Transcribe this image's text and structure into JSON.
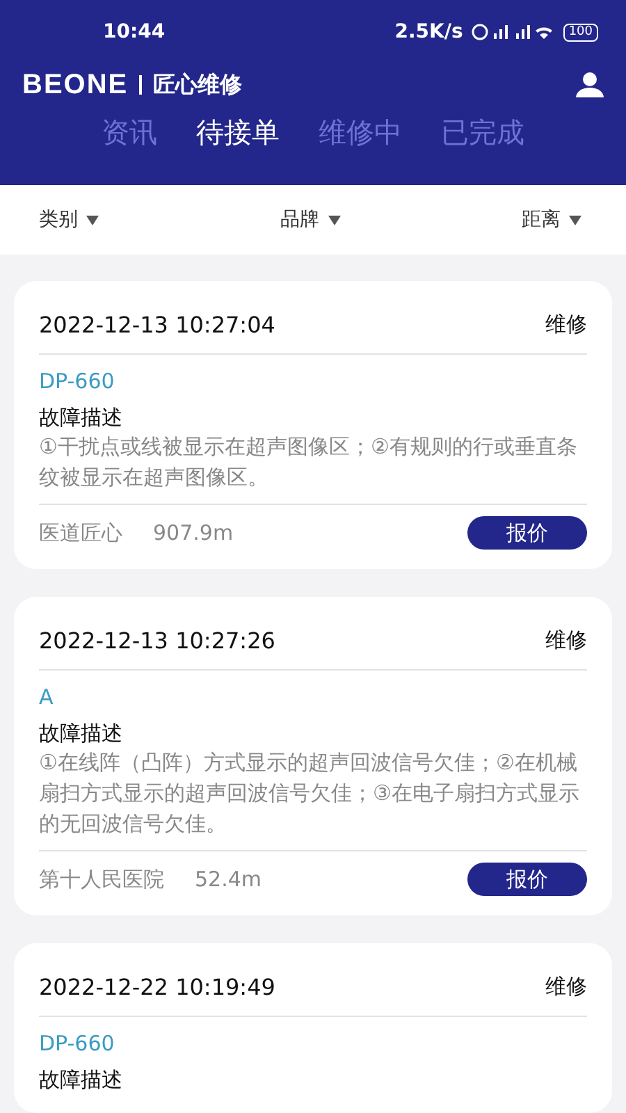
{
  "status_bar": {
    "time": "10:44",
    "speed": "2.5K/s",
    "battery": "100"
  },
  "header": {
    "logo": "BEONE",
    "title": "匠心维修"
  },
  "tabs": [
    {
      "label": "资讯",
      "selected": false
    },
    {
      "label": "待接单",
      "selected": true
    },
    {
      "label": "维修中",
      "selected": false
    },
    {
      "label": "已完成",
      "selected": false
    }
  ],
  "filters": [
    {
      "label": "类别"
    },
    {
      "label": "品牌"
    },
    {
      "label": "距离"
    }
  ],
  "orders": [
    {
      "time": "2022-12-13 10:27:04",
      "type": "维修",
      "model": "DP-660",
      "desc_title": "故障描述",
      "desc": "①干扰点或线被显示在超声图像区；②有规则的行或垂直条纹被显示在超声图像区。",
      "hospital": "医道匠心",
      "distance": "907.9m",
      "action": "报价"
    },
    {
      "time": "2022-12-13 10:27:26",
      "type": "维修",
      "model": "A",
      "desc_title": "故障描述",
      "desc": "①在线阵（凸阵）方式显示的超声回波信号欠佳；②在机械扇扫方式显示的超声回波信号欠佳；③在电子扇扫方式显示的无回波信号欠佳。",
      "hospital": "第十人民医院",
      "distance": "52.4m",
      "action": "报价"
    },
    {
      "time": "2022-12-22 10:19:49",
      "type": "维修",
      "model": "DP-660",
      "desc_title": "故障描述"
    }
  ]
}
